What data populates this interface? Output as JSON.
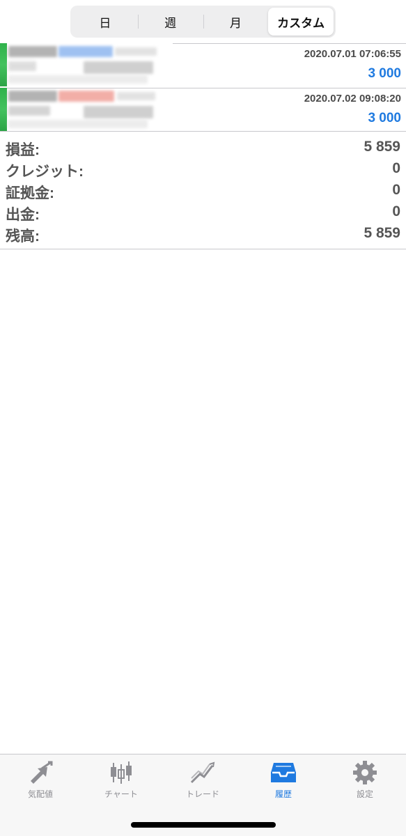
{
  "period_tabs": [
    {
      "label": "日",
      "active": false
    },
    {
      "label": "週",
      "active": false
    },
    {
      "label": "月",
      "active": false
    },
    {
      "label": "カスタム",
      "active": true
    }
  ],
  "deals": [
    {
      "time": "2020.07.01 07:06:55",
      "amount": "3 000"
    },
    {
      "time": "2020.07.02 09:08:20",
      "amount": "3 000"
    }
  ],
  "summary": {
    "profit": {
      "label": "損益:",
      "value": "5 859"
    },
    "credit": {
      "label": "クレジット:",
      "value": "0"
    },
    "deposit": {
      "label": "証拠金:",
      "value": "0"
    },
    "withdrawal": {
      "label": "出金:",
      "value": "0"
    },
    "balance": {
      "label": "残高:",
      "value": "5 859"
    }
  },
  "tabbar": {
    "items": [
      {
        "label": "気配値",
        "icon": "quotes-arrow-icon",
        "active": false
      },
      {
        "label": "チャート",
        "icon": "candlestick-icon",
        "active": false
      },
      {
        "label": "トレード",
        "icon": "trade-chart-icon",
        "active": false
      },
      {
        "label": "履歴",
        "icon": "inbox-history-icon",
        "active": true
      },
      {
        "label": "設定",
        "icon": "gear-icon",
        "active": false
      }
    ]
  },
  "colors": {
    "accent": "#1f7ae0",
    "inactive": "#8e8e93",
    "text": "#555555",
    "buy_marker": "#2fb24b"
  }
}
